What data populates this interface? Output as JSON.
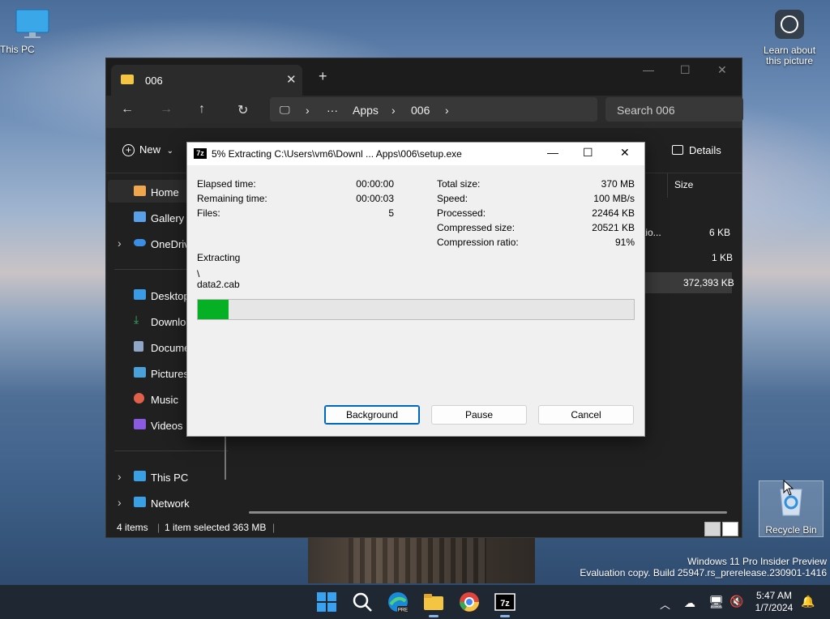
{
  "desktop": {
    "this_pc": "This PC",
    "learn": "Learn about this picture",
    "recycle_bin": "Recycle Bin",
    "watermark_line1": "Windows 11 Pro Insider Preview",
    "watermark_line2": "Evaluation copy. Build 25947.rs_prerelease.230901-1416"
  },
  "explorer": {
    "tab_title": "006",
    "new_tab": "+",
    "breadcrumb": [
      "Apps",
      "006"
    ],
    "breadcrumb_more": "···",
    "search_placeholder": "Search 006",
    "new_label": "New",
    "details_label": "Details",
    "sidebar": [
      {
        "label": "Home",
        "icon": "home-icon",
        "color": "#f0a64d"
      },
      {
        "label": "Gallery",
        "icon": "gallery-icon",
        "color": "#5aa0e6"
      },
      {
        "label": "OneDrive",
        "icon": "onedrive-icon",
        "color": "#3a8ee6"
      },
      {
        "label": "Desktop",
        "icon": "desktop-icon",
        "color": "#3a9ae6"
      },
      {
        "label": "Downloads",
        "icon": "download-icon",
        "color": "#3ab06a"
      },
      {
        "label": "Documents",
        "icon": "documents-icon",
        "color": "#8fa6c8"
      },
      {
        "label": "Pictures",
        "icon": "pictures-icon",
        "color": "#4aa0d8"
      },
      {
        "label": "Music",
        "icon": "music-icon",
        "color": "#e0604a"
      },
      {
        "label": "Videos",
        "icon": "videos-icon",
        "color": "#8a5ae0"
      },
      {
        "label": "This PC",
        "icon": "this-pc-icon",
        "color": "#3aa0e6"
      },
      {
        "label": "Network",
        "icon": "network-icon",
        "color": "#3aa0e6"
      }
    ],
    "column_size": "Size",
    "rows": [
      {
        "name": "tio...",
        "size": "6 KB"
      },
      {
        "name": "",
        "size": "1 KB"
      },
      {
        "name": "",
        "size": "372,393 KB"
      }
    ],
    "status": {
      "items": "4 items",
      "selected": "1 item selected  363 MB"
    }
  },
  "dialog": {
    "title": "5% Extracting C:\\Users\\vm6\\Downl ... Apps\\006\\setup.exe",
    "logo": "7z",
    "left_stats": [
      {
        "label": "Elapsed time:",
        "value": "00:00:00"
      },
      {
        "label": "Remaining time:",
        "value": "00:00:03"
      },
      {
        "label": "Files:",
        "value": "5"
      }
    ],
    "right_stats": [
      {
        "label": "Total size:",
        "value": "370 MB"
      },
      {
        "label": "Speed:",
        "value": "100 MB/s"
      },
      {
        "label": "Processed:",
        "value": "22464 KB"
      },
      {
        "label": "Compressed size:",
        "value": "20521 KB"
      },
      {
        "label": "Compression ratio:",
        "value": "91%"
      }
    ],
    "operation": "Extracting",
    "path": "\\",
    "file": "data2.cab",
    "progress_fraction": 0.07,
    "progress_color": "#06b025",
    "buttons": {
      "background": "Background",
      "pause": "Pause",
      "cancel": "Cancel"
    }
  },
  "taskbar": {
    "apps": [
      "start-icon",
      "search-icon",
      "edge-icon",
      "file-explorer-icon",
      "chrome-icon",
      "7zip-icon"
    ],
    "time": "5:47 AM",
    "date": "1/7/2024"
  }
}
